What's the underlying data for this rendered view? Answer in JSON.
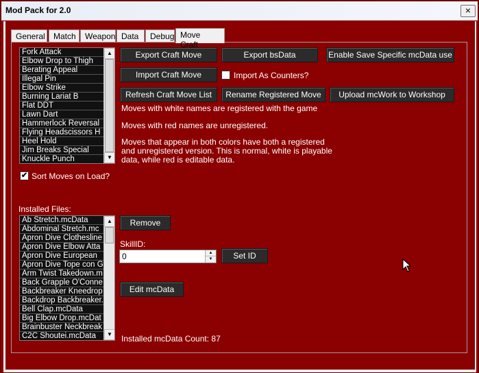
{
  "window": {
    "title": "Mod Pack for 2.0",
    "close_glyph": "×"
  },
  "tabs": [
    "General",
    "Match",
    "Weapon",
    "Data",
    "Debug",
    "Move Craft"
  ],
  "active_tab": "Move Craft",
  "moves_list": [
    "Fork Attack",
    "Elbow Drop to Thigh",
    "Berating Appeal",
    "Illegal Pin",
    "Elbow Strike",
    "Burning Lariat B",
    "Flat DDT",
    "Lawn Dart",
    "Hammerlock Reversal",
    "Flying Headscissors H",
    "Heel Hold",
    "Jim Breaks Special",
    "Knuckle Punch"
  ],
  "buttons": {
    "export_craft": "Export Craft Move",
    "export_bs": "Export bsData",
    "enable_save": "Enable Save Specific mcData use",
    "import_craft": "Import Craft Move",
    "refresh": "Refresh Craft Move List",
    "rename": "Rename Registered Move",
    "upload": "Upload mcWork to Workshop",
    "remove": "Remove",
    "set_id": "Set ID",
    "edit": "Edit mcData"
  },
  "checks": {
    "import_counters": "Import As Counters?",
    "sort_moves": "Sort Moves on Load?",
    "checkmark": "✔"
  },
  "info": {
    "white": "Moves with white names are registered with the game",
    "red": "Moves with red names are unregistered.",
    "both_line1": "Moves that appear in both colors have both a registered",
    "both_line2": "and unregistered version. This is normal, white is playable",
    "both_line3": "data, while red is editable data."
  },
  "installed_label": "Installed Files:",
  "installed_files": [
    "Ab Stretch.mcData",
    "Abdominal Stretch.mc",
    "Apron Dive Clothesline",
    "Apron Dive Elbow Atta",
    "Apron Dive European",
    "Apron Dive Tope con G",
    "Arm Twist Takedown.m",
    "Back Grapple O'Conne",
    "Backbreaker Kneedrop",
    "Backdrop Backbreaker.",
    "Bell Clap.mcData",
    "Big Elbow Drop.mcDat",
    "Brainbuster Neckbreak",
    "C2C Shoutei.mcData"
  ],
  "skill": {
    "label": "SkillID:",
    "value": "0"
  },
  "count_label": "Installed mcData Count: 87",
  "scroll": {
    "up": "▲",
    "down": "▼"
  },
  "colors": {
    "background": "#8b0000",
    "button": "#2b2b2b",
    "list": "#0a0a0a"
  }
}
